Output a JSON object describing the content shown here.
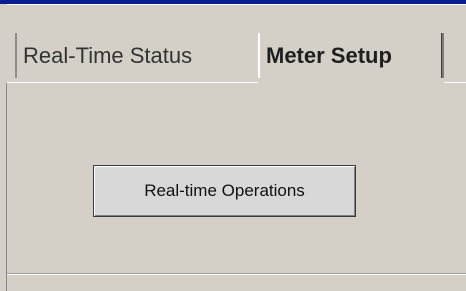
{
  "tabs": [
    {
      "label": "Real-Time Status",
      "selected": false
    },
    {
      "label": "Meter Setup",
      "selected": true
    }
  ],
  "main": {
    "operations_button_label": "Real-time Operations"
  }
}
